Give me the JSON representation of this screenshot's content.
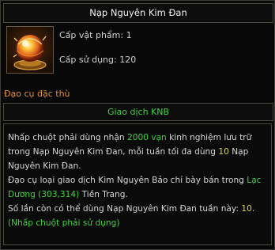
{
  "item": {
    "name": "Nạp Nguyên Kim Đan",
    "icon": "golden-elixir-orb-icon",
    "level_label": "Cấp vật phẩm: 1",
    "use_level_label": "Cấp sử dụng: 120",
    "special_label": "Đạo cụ đặc thù",
    "trade_label": "Giao dịch KNB"
  },
  "description": {
    "line1_a": "Nhấp chuột phải dùng nhận ",
    "line1_amount": "2000 vạn",
    "line1_b": " kinh nghiệm lưu trữ trong Nạp Nguyên Kim Đan, mỗi tuần tối đa dùng ",
    "line1_count": "10",
    "line1_c": " Nạp Nguyên Kim Đan.",
    "line2_a": "Đạo cụ loại giao dịch Kim Nguyên Bảo chỉ bày bán trong ",
    "line2_location": "Lạc Dương (303,314)",
    "line2_b": " Tiền Trang.",
    "line3_a": "Số lần còn có thể dùng Nạp Nguyên Kim Đan tuần này: ",
    "line3_remaining": "10",
    "line3_b": ".",
    "hint": "(Nhấp chuột phải sử dụng)"
  },
  "colors": {
    "highlight_green": "#3fd23f",
    "count_yellow": "#d9d94a",
    "special_orange": "#e09030",
    "text_light": "#d6d6d6"
  }
}
